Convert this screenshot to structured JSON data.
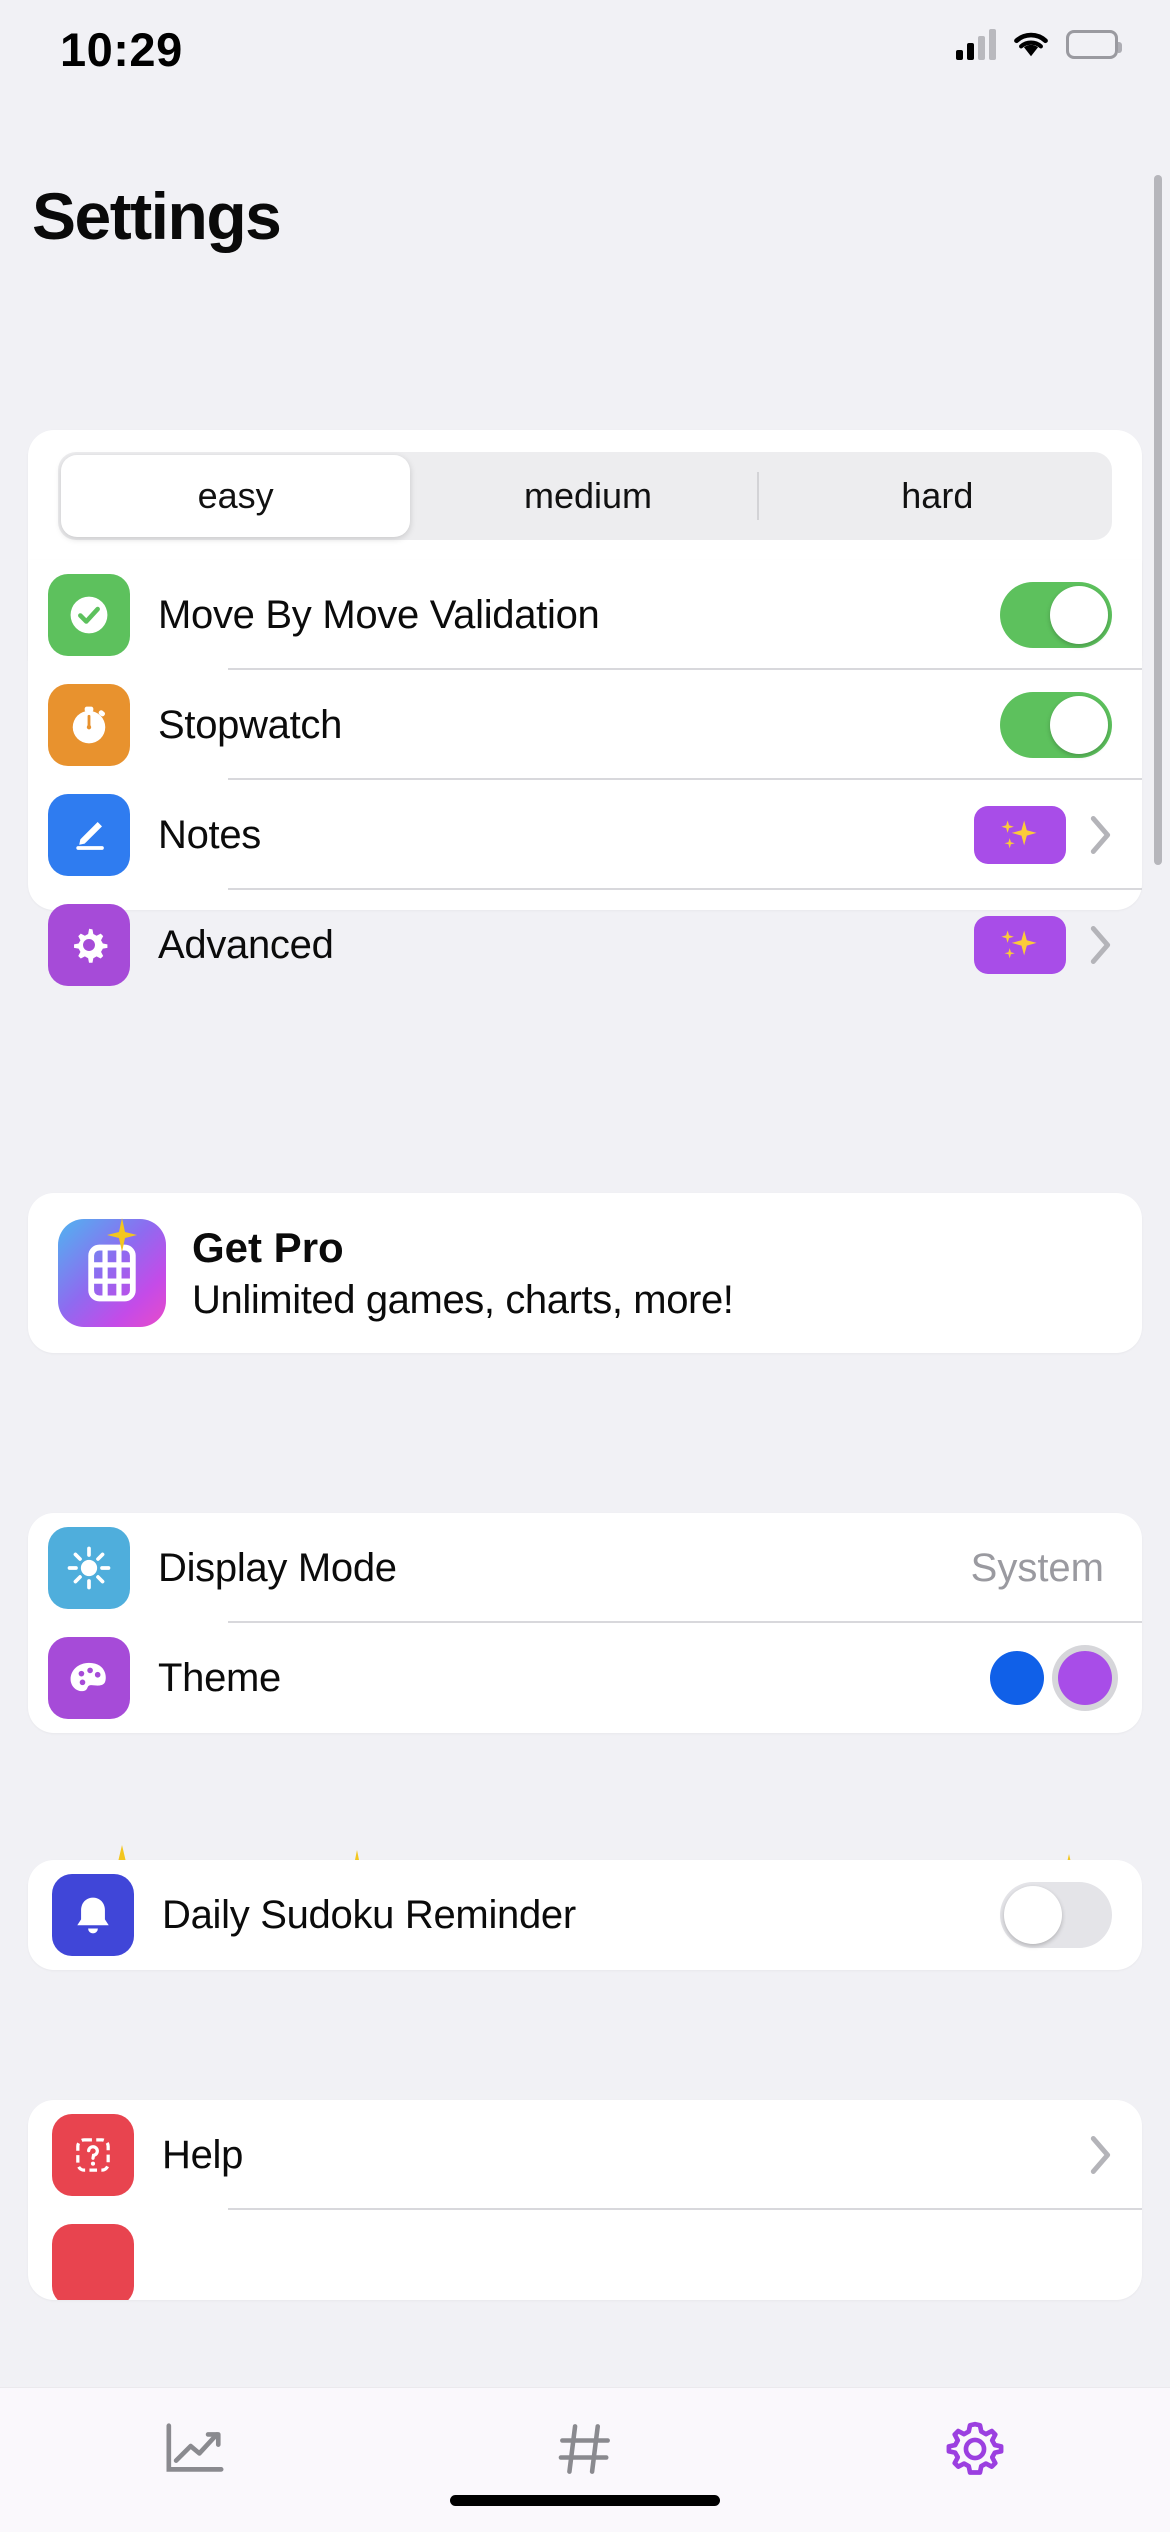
{
  "status_bar": {
    "time": "10:29",
    "cellular_icon": "cellular-signal-icon",
    "wifi_icon": "wifi-icon",
    "battery_icon": "battery-icon"
  },
  "header": {
    "title": "Settings"
  },
  "difficulty": {
    "options": [
      {
        "label": "easy",
        "selected": true
      },
      {
        "label": "medium",
        "selected": false
      },
      {
        "label": "hard",
        "selected": false
      }
    ]
  },
  "game_settings": {
    "rows": [
      {
        "label": "Move By Move Validation",
        "icon": "check-circle-icon",
        "icon_color": "#5DC15D",
        "control": "toggle",
        "toggle_on": true
      },
      {
        "label": "Stopwatch",
        "icon": "stopwatch-icon",
        "icon_color": "#E8922E",
        "control": "toggle",
        "toggle_on": true
      },
      {
        "label": "Notes",
        "icon": "pencil-icon",
        "icon_color": "#2F7CF0",
        "control": "sparkle-chevron"
      },
      {
        "label": "Advanced",
        "icon": "gear-icon",
        "icon_color": "#A64BD8",
        "control": "sparkle-chevron"
      }
    ]
  },
  "get_pro": {
    "title": "Get Pro",
    "subtitle": "Unlimited games, charts, more!",
    "icon": "sudoku-grid-icon",
    "sparkle_color": "#F5C518"
  },
  "appearance": {
    "rows": [
      {
        "label": "Display Mode",
        "icon": "sun-icon",
        "icon_color": "#4FAEDC",
        "value": "System"
      },
      {
        "label": "Theme",
        "icon": "palette-icon",
        "icon_color": "#A64BD8",
        "colors": [
          "#1060E8",
          "#A84DE8"
        ],
        "selected_index": 1
      }
    ]
  },
  "notifications": {
    "rows": [
      {
        "label": "Daily Sudoku Reminder",
        "icon": "bell-icon",
        "icon_color": "#4046D8",
        "toggle_on": false
      }
    ]
  },
  "support": {
    "rows": [
      {
        "label": "Help",
        "icon": "help-icon",
        "icon_color": "#E8444F"
      }
    ]
  },
  "tab_bar": {
    "tabs": [
      {
        "name": "statistics",
        "icon": "chart-line-icon",
        "active": false
      },
      {
        "name": "game",
        "icon": "grid-icon",
        "active": false
      },
      {
        "name": "settings",
        "icon": "gear-icon",
        "active": true
      }
    ],
    "active_color": "#9B3FE0",
    "inactive_color": "#8A8A8F"
  }
}
